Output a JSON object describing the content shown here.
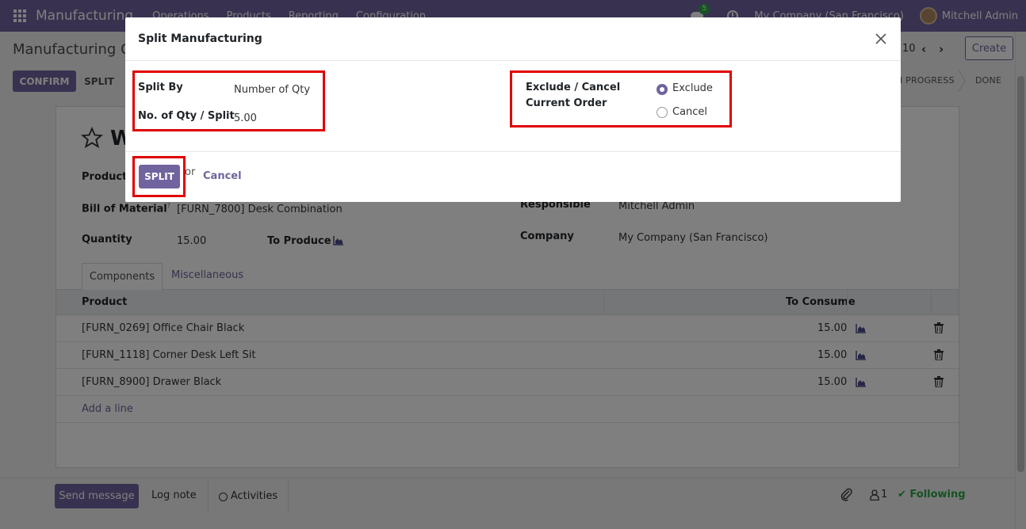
{
  "navbar": {
    "app_name": "Manufacturing",
    "menu": [
      "Operations",
      "Products",
      "Reporting",
      "Configuration"
    ],
    "chat_badge": "5",
    "company": "My Company (San Francisco)",
    "user": "Mitchell Admin"
  },
  "control_panel": {
    "breadcrumb": "Manufacturing Or",
    "pager": "10",
    "create_label": "Create",
    "confirm_label": "CONFIRM",
    "split_label": "SPLIT",
    "status_inprogress": "N PROGRESS",
    "status_done": "DONE"
  },
  "form": {
    "title_fragment": "W",
    "product_label": "Product",
    "bom_label": "Bill of Material",
    "bom_tooltip": "?",
    "bom_value": "[FURN_7800] Desk Combination",
    "quantity_label": "Quantity",
    "quantity_value": "15.00",
    "to_produce_label": "To Produce",
    "responsible_label": "Responsible",
    "responsible_value": "Mitchell Admin",
    "company_label": "Company",
    "company_value": "My Company (San Francisco)",
    "tabs": [
      "Components",
      "Miscellaneous"
    ],
    "table": {
      "col_product": "Product",
      "col_to_consume": "To Consume",
      "rows": [
        {
          "product": "[FURN_0269] Office Chair Black",
          "qty": "15.00"
        },
        {
          "product": "[FURN_1118] Corner Desk Left Sit",
          "qty": "15.00"
        },
        {
          "product": "[FURN_8900] Drawer Black",
          "qty": "15.00"
        }
      ],
      "add_line": "Add a line"
    }
  },
  "chatter": {
    "send_message": "Send message",
    "log_note": "Log note",
    "activities": "Activities",
    "followers_count": "1",
    "following": "Following"
  },
  "modal": {
    "title": "Split Manufacturing",
    "split_by_label": "Split By",
    "split_by_value": "Number of Qty",
    "qty_per_split_label": "No. of Qty / Split",
    "qty_per_split_value": "5.00",
    "exclude_cancel_label": "Exclude / Cancel Current Order",
    "option_exclude": "Exclude",
    "option_cancel": "Cancel",
    "selected_option": "Exclude",
    "split_button": "SPLIT",
    "or_text": "or",
    "cancel_link": "Cancel"
  },
  "colors": {
    "brand": "#71639e",
    "highlight": "#e00000",
    "following": "#28a745"
  }
}
